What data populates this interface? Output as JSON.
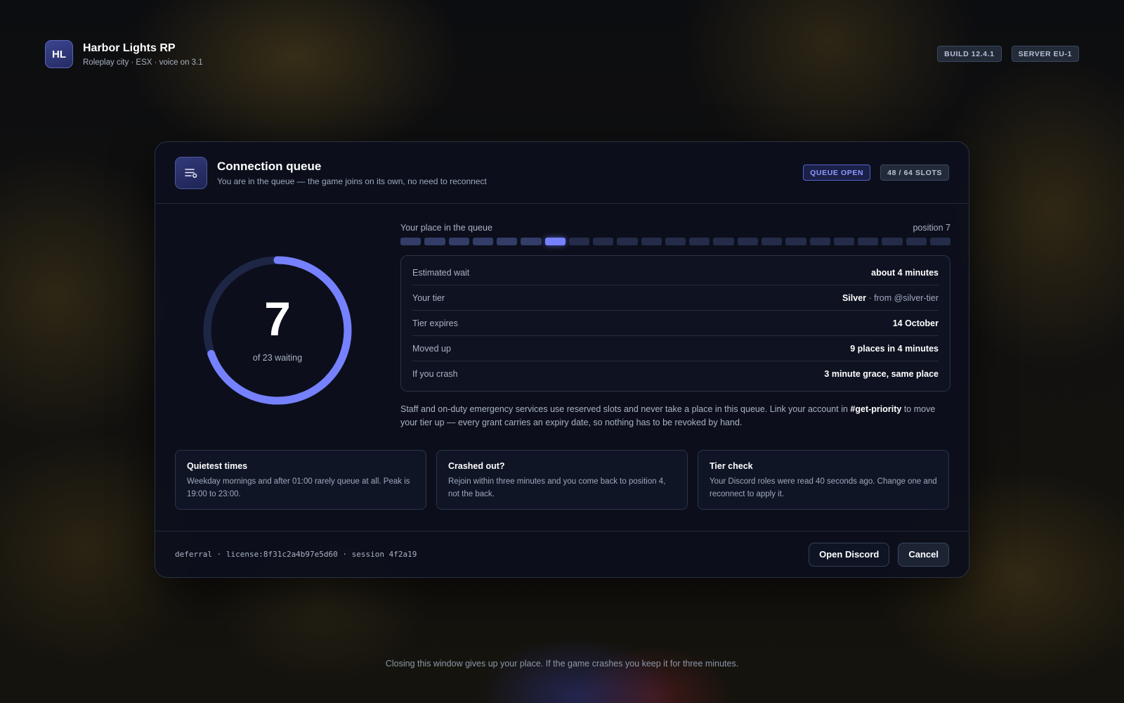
{
  "brand": {
    "initials": "HL",
    "title": "Harbor Lights RP",
    "subtitle": "Roleplay city · ESX · voice on 3.1"
  },
  "top_badges": {
    "build": "BUILD 12.4.1",
    "server": "SERVER EU-1"
  },
  "panel": {
    "icon": "queue-list-icon",
    "title": "Connection queue",
    "subtitle": "You are in the queue — the game joins on its own, no need to reconnect",
    "status_badge": "QUEUE OPEN",
    "slots_badge": "48 / 64 SLOTS"
  },
  "queue": {
    "position": "7",
    "waiting_label": "of 23 waiting",
    "position_number": 7,
    "total_waiting": 23,
    "place_label": "Your place in the queue",
    "position_label": "position 7"
  },
  "details": [
    {
      "label": "Estimated wait",
      "value": "about 4 minutes",
      "extra": ""
    },
    {
      "label": "Your tier",
      "value": "Silver",
      "extra": " · from @silver-tier"
    },
    {
      "label": "Tier expires",
      "value": "14 October",
      "extra": ""
    },
    {
      "label": "Moved up",
      "value": "9 places in 4 minutes",
      "extra": ""
    },
    {
      "label": "If you crash",
      "value": "3 minute grace, same place",
      "extra": ""
    }
  ],
  "note": {
    "before": "Staff and on-duty emergency services use reserved slots and never take a place in this queue. Link your account in ",
    "channel": "#get-priority",
    "after": " to move your tier up — every grant carries an expiry date, so nothing has to be revoked by hand."
  },
  "tips": [
    {
      "title": "Quietest times",
      "body": "Weekday mornings and after 01:00 rarely queue at all. Peak is 19:00 to 23:00."
    },
    {
      "title": "Crashed out?",
      "body": "Rejoin within three minutes and you come back to position 4, not the back."
    },
    {
      "title": "Tier check",
      "body": "Your Discord roles were read 40 seconds ago. Change one and reconnect to apply it."
    }
  ],
  "footer": {
    "meta": "deferral · license:8f31c2a4b97e5d60 · session 4f2a19",
    "discord_label": "Open Discord",
    "cancel_label": "Cancel"
  },
  "bottom_note": "Closing this window gives up your place. If the game crashes you keep it for three minutes.",
  "colors": {
    "accent": "#7581ff",
    "ring_track": "#1e2646"
  }
}
